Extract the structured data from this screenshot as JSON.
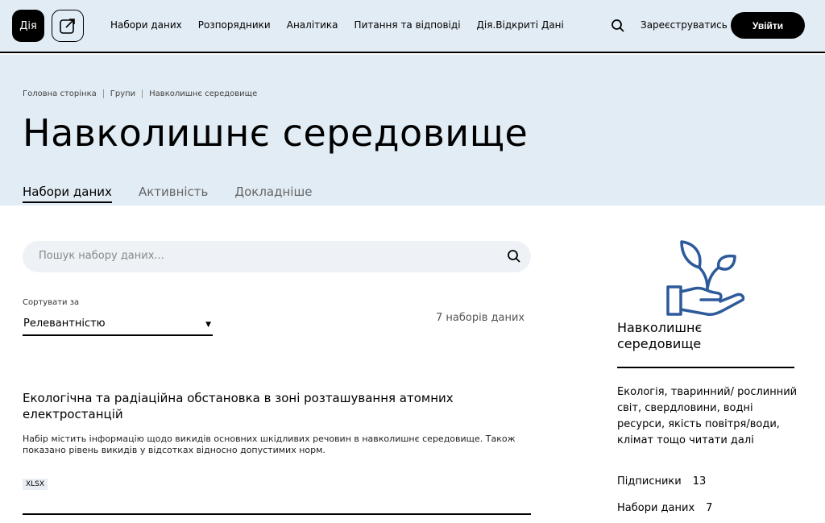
{
  "header": {
    "logo": "Дія",
    "nav": [
      "Набори даних",
      "Розпорядники",
      "Аналітика",
      "Питання та відповіді",
      "Дія.Відкриті Дані"
    ],
    "register_label": "Зареєструватись",
    "login_label": "Увійти"
  },
  "hero": {
    "breadcrumb": [
      "Головна сторінка",
      "Групи",
      "Навколишнє середовище"
    ],
    "title": "Навколишнє середовище",
    "tabs": [
      "Набори даних",
      "Активність",
      "Докладніше"
    ],
    "active_tab": "Набори даних"
  },
  "search": {
    "placeholder": "Пошук набору даних..."
  },
  "sort": {
    "label": "Сортувати за",
    "value": "Релевантністю"
  },
  "results_count": "7 наборів даних",
  "datasets": [
    {
      "title": "Екологічна та радіаційна обстановка в зоні розташування атомних електростанцій",
      "description": "Набір містить інформацію щодо викидів основних шкідливих речовин в навколишнє середовище. Також показано рівень викидів у відсотках відносно допустимих норм.",
      "format": "XLSX"
    }
  ],
  "sidebar": {
    "icon": "plant-hand-icon",
    "title": "Навколишнє середовище",
    "description": "Екологія, тваринний/ рослинний світ, свердловини, водні ресурси, якість повітря/води, клімат тощо читати далі",
    "subscribers_label": "Підписники",
    "subscribers_value": "13",
    "datasets_label": "Набори даних",
    "datasets_value": "7"
  },
  "colors": {
    "accent": "#000000",
    "hero_bg": "#e2ecf4",
    "icon_blue": "#2d5a9b"
  }
}
